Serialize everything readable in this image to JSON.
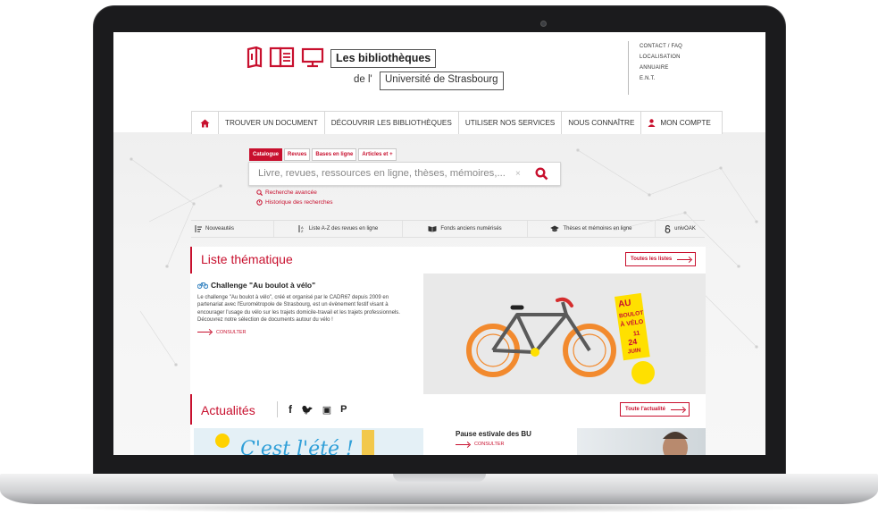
{
  "header": {
    "title_line1": "Les bibliothèques",
    "title_prefix": "de l'",
    "title_line2": "Université de Strasbourg",
    "top_links": [
      "CONTACT / FAQ",
      "LOCALISATION",
      "ANNUAIRE",
      "E.N.T."
    ]
  },
  "nav": {
    "home_icon": "home-icon",
    "items": [
      "TROUVER UN DOCUMENT",
      "DÉCOUVRIR LES BIBLIOTHÈQUES",
      "UTILISER NOS SERVICES",
      "NOUS CONNAÎTRE",
      "MON COMPTE"
    ]
  },
  "search": {
    "tabs": [
      "Catalogue",
      "Revues",
      "Bases en ligne",
      "Articles et +"
    ],
    "active_tab": "Catalogue",
    "placeholder": "Livre, revues, ressources en ligne, thèses, mémoires,...",
    "clear": "×",
    "advanced": "Recherche avancée",
    "history": "Historique des recherches"
  },
  "quick_links": [
    "Nouveautés",
    "Liste A-Z des revues en ligne",
    "Fonds anciens numérisés",
    "Thèses et mémoires en ligne",
    "univOAK"
  ],
  "thematic": {
    "title": "Liste thématique",
    "see_all": "Toutes les listes",
    "item_title": "Challenge \"Au boulot à vélo\"",
    "item_text": "Le challenge \"Au boulot à vélo\", créé et organisé par le CADR67 depuis 2009 en partenariat avec l'Eurométropole de Strasbourg, est un évènement festif visant à encourager l'usage du vélo sur les trajets domicile-travail et les trajets professionnels. Découvrez notre sélection de documents autour du vélo !",
    "consult": "CONSULTER",
    "poster_lines": [
      "AU",
      "BOULOT",
      "À VÉLO",
      "11",
      "24",
      "JUIN"
    ]
  },
  "news": {
    "title": "Actualités",
    "see_all": "Toute l'actualité",
    "social_icons": [
      "facebook-icon",
      "twitter-icon",
      "youtube-icon",
      "pinterest-icon"
    ],
    "social_glyphs": [
      "f",
      "🐦",
      "▣",
      "P"
    ],
    "item_title": "Pause estivale des BU",
    "consult": "CONSULTER",
    "banner_text": "C'est l'été !"
  },
  "colors": {
    "accent": "#c8102e",
    "yellow": "#ffe000"
  }
}
